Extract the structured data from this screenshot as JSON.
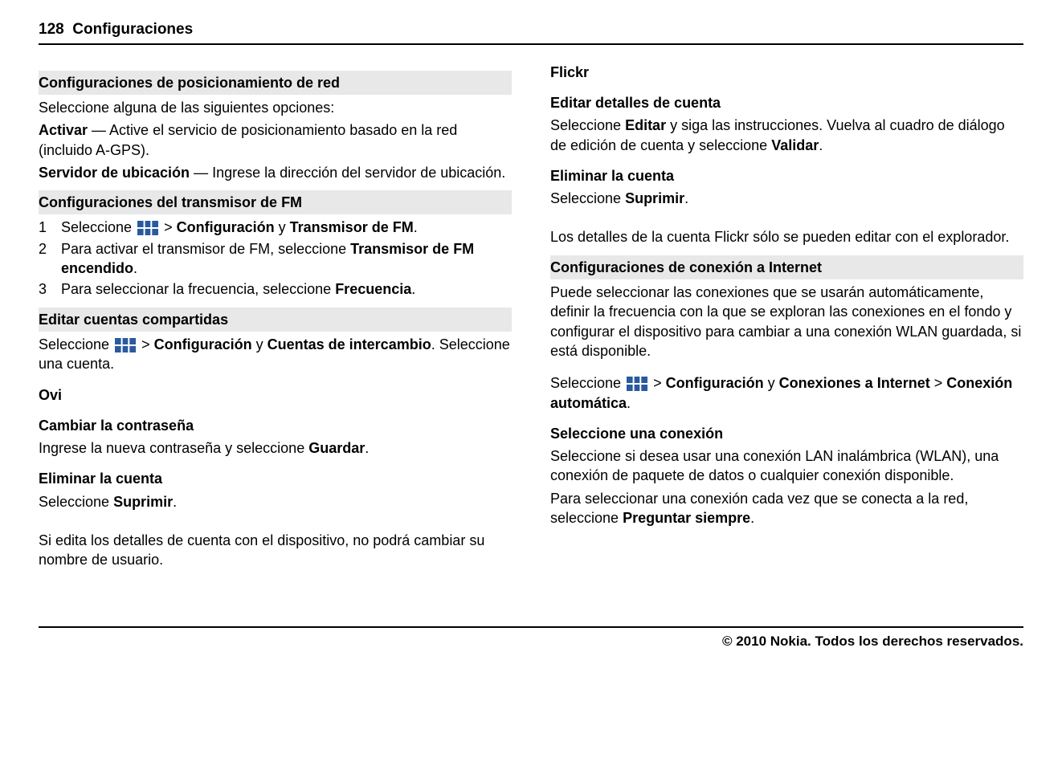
{
  "page": {
    "number": "128",
    "section": "Configuraciones"
  },
  "footer": "© 2010 Nokia. Todos los derechos reservados.",
  "t": {
    "gt": ">",
    "seleccione": "Seleccione",
    "seleccione_sp": "Seleccione ",
    "y": "y",
    "configuracion": "Configuración",
    "validar": "Validar",
    "suprimir": "Suprimir",
    "editar": "Editar",
    "preguntar_siempre": "Preguntar siempre",
    "guardar": "Guardar",
    "transmisor_fm": "Transmisor de FM",
    "frecuencia": "Frecuencia",
    "transmisor_fm_enc": "Transmisor de FM encendido",
    "cuentas_intercambio": "Cuentas de intercambio",
    "conexiones_internet": "Conexiones a Internet",
    "conexion_auto": "Conexión automática"
  },
  "left": {
    "pos_red": {
      "title": "Configuraciones de posicionamiento de red",
      "intro": "Seleccione alguna de las siguientes opciones:",
      "activar_label": "Activar",
      "activar_text": " — Active el servicio de posicionamiento basado en la red (incluido A-GPS).",
      "servidor_label": "Servidor de ubicación",
      "servidor_text": " — Ingrese la dirección del servidor de ubicación."
    },
    "fm": {
      "title": "Configuraciones del transmisor de FM",
      "step2_pre": "Para activar el transmisor de FM, seleccione ",
      "step3_pre": "Para seleccionar la frecuencia, seleccione "
    },
    "shared": {
      "title": "Editar cuentas compartidas",
      "after": ". Seleccione una cuenta."
    },
    "ovi": {
      "title": "Ovi"
    },
    "cambiar": {
      "title": "Cambiar la contraseña",
      "text_pre": "Ingrese la nueva contraseña y seleccione "
    },
    "eliminar": {
      "title": "Eliminar la cuenta"
    },
    "note": "Si edita los detalles de cuenta con el dispositivo, no podrá cambiar su nombre de usuario."
  },
  "right": {
    "flickr": {
      "title": "Flickr",
      "editar_title": "Editar detalles de cuenta",
      "editar_mid": " y siga las instrucciones. Vuelva al cuadro de diálogo de edición de cuenta y seleccione ",
      "eliminar_title": "Eliminar la cuenta",
      "note": "Los detalles de la cuenta Flickr sólo se pueden editar con el explorador."
    },
    "internet": {
      "title": "Configuraciones de conexión a Internet",
      "intro": "Puede seleccionar las conexiones que se usarán automáticamente, definir la frecuencia con la que se exploran las conexiones en el fondo y configurar el dispositivo para cambiar a una conexión WLAN guardada, si está disponible.",
      "sel_title": "Seleccione una conexión",
      "sel_text": "Seleccione si desea usar una conexión LAN inalámbrica (WLAN), una conexión de paquete de datos o cualquier conexión disponible.",
      "sel_text2_pre": "Para seleccionar una conexión cada vez que se conecta a la red, seleccione "
    }
  }
}
